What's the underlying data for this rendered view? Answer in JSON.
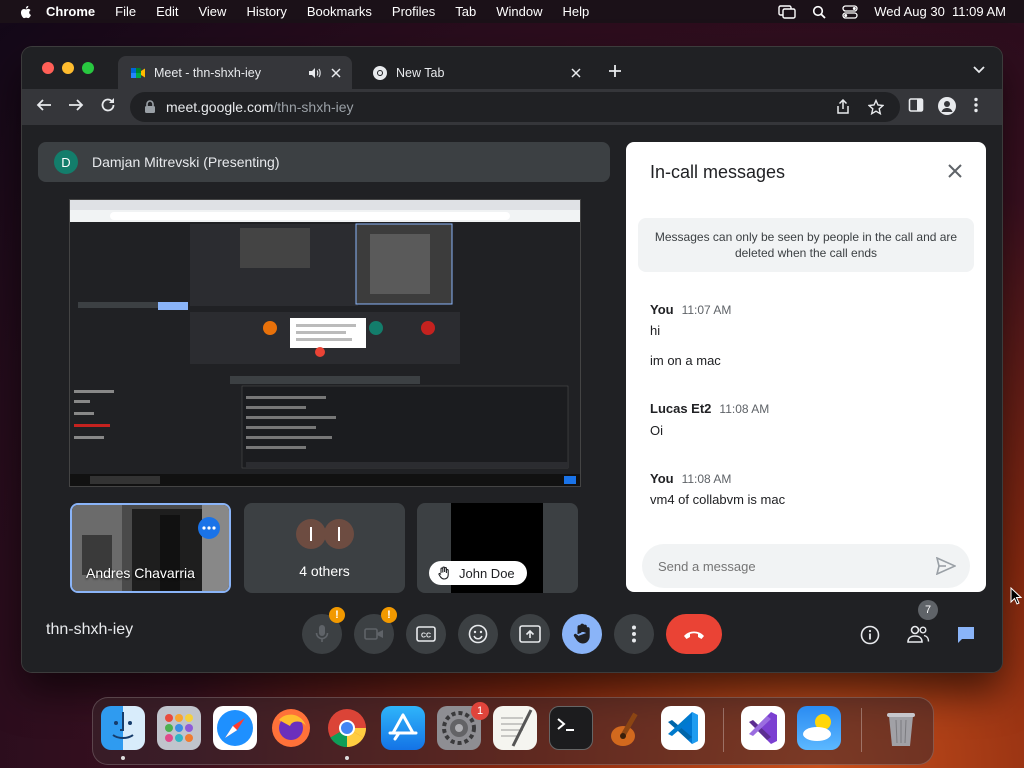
{
  "menubar": {
    "app_name": "Chrome",
    "items": [
      "File",
      "Edit",
      "View",
      "History",
      "Bookmarks",
      "Profiles",
      "Tab",
      "Window",
      "Help"
    ],
    "clock": "Wed Aug 30  11:09 AM"
  },
  "browser": {
    "tabs": [
      {
        "title": "Meet - thn-shxh-iey",
        "active": true,
        "icon": "google-meet-icon"
      },
      {
        "title": "New Tab",
        "active": false,
        "icon": "chrome-icon"
      }
    ],
    "url": {
      "host": "meet.google.com",
      "path": "/thn-shxh-iey"
    }
  },
  "meet": {
    "presenter": {
      "initial": "D",
      "label": "Damjan Mitrevski (Presenting)"
    },
    "tiles": [
      {
        "label": "Andres Chavarria",
        "more_icon": "more-dots-icon"
      },
      {
        "label": "4 others"
      },
      {
        "label": "John Doe",
        "icon": "raised-hand-icon"
      }
    ],
    "meeting_code": "thn-shxh-iey",
    "participant_count": "7",
    "colors": {
      "end_call": "#ea4335",
      "raised_hand": "#8ab4f8",
      "warning": "#f29900"
    }
  },
  "chat": {
    "title": "In-call messages",
    "notice": "Messages can only be seen by people in the call and are deleted when the call ends",
    "messages": [
      {
        "sender": "You",
        "time": "11:07 AM",
        "lines": [
          "hi",
          "im on a mac"
        ]
      },
      {
        "sender": "Lucas Et2",
        "time": "11:08 AM",
        "lines": [
          "Oi"
        ]
      },
      {
        "sender": "You",
        "time": "11:08 AM",
        "lines": [
          "vm4 of collabvm is mac"
        ]
      }
    ],
    "input_placeholder": "Send a message"
  },
  "dock": {
    "apps": [
      "Finder",
      "Launchpad",
      "Safari",
      "Firefox",
      "Google Chrome",
      "App Store",
      "System Settings",
      "TextEdit",
      "Terminal",
      "GarageBand",
      "Visual Studio Code",
      "Visual Studio",
      "Weather",
      "Trash"
    ],
    "settings_badge": "1"
  }
}
